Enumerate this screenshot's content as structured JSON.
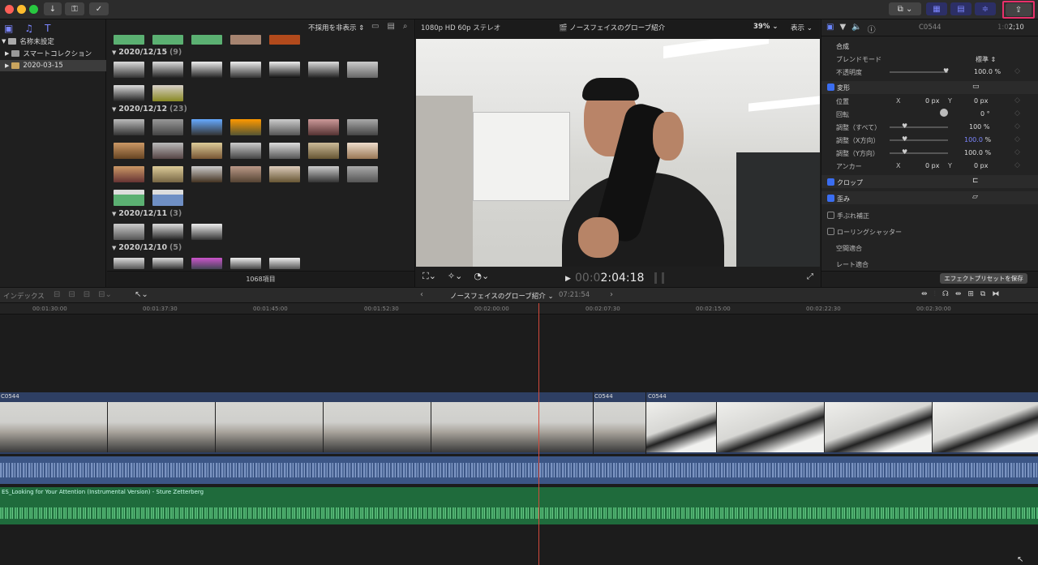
{
  "toolbar": {
    "export_icon": "share-export-icon",
    "import_icon": "download-arrow-icon",
    "key_icon": "keywords-icon",
    "check_icon": "background-tasks-icon"
  },
  "library": {
    "items": [
      {
        "label": "名称未設定"
      },
      {
        "label": "スマートコレクション"
      },
      {
        "label": "2020-03-15"
      }
    ]
  },
  "browser": {
    "filter_label": "不採用を非表示 ⇕",
    "groups": [
      {
        "date": "2020/12/15",
        "count": "(9)"
      },
      {
        "date": "2020/12/12",
        "count": "(23)"
      },
      {
        "date": "2020/12/11",
        "count": "(3)"
      },
      {
        "date": "2020/12/10",
        "count": "(5)"
      }
    ],
    "item_count": "1068項目"
  },
  "viewer": {
    "format": "1080p HD 60p ステレオ",
    "title": "ノースフェイスのグローブ紹介",
    "zoom": "39%",
    "view_menu": "表示",
    "timecode_dim": "00:0",
    "timecode": "2:04:18"
  },
  "inspector": {
    "clip_name": "C0544",
    "duration_dim": "1:0",
    "duration": "2;10",
    "compositing": "合成",
    "blend_mode_label": "ブレンドモード",
    "blend_mode_value": "標準 ⇕",
    "opacity_label": "不透明度",
    "opacity_value": "100.0",
    "transform": "変形",
    "position_label": "位置",
    "x": "X",
    "y": "Y",
    "pos_x": "0",
    "pos_y": "0",
    "px": "px",
    "rotation_label": "回転",
    "rotation_value": "0",
    "degree": "°",
    "scale_all_label": "調整（すべて）",
    "scale_all_value": "100",
    "scale_x_label": "調整（X方向）",
    "scale_x_value": "100.0",
    "scale_y_label": "調整（Y方向）",
    "scale_y_value": "100.0",
    "percent": "%",
    "anchor_label": "アンカー",
    "anchor_x": "0",
    "anchor_y": "0",
    "crop": "クロップ",
    "distort": "歪み",
    "stabilization": "手ぶれ補正",
    "rolling_shutter": "ローリングシャッター",
    "spatial_conform": "空間適合",
    "rate_conform": "レート適合",
    "save_preset": "エフェクトプリセットを保存"
  },
  "timeline": {
    "index": "インデックス",
    "project": "ノースフェイスのグローブ紹介",
    "project_duration": "07:21:54",
    "ruler": [
      "00:01:30:00",
      "00:01:37:30",
      "00:01:45:00",
      "00:01:52:30",
      "00:02:00:00",
      "00:02:07:30",
      "00:02:15:00",
      "00:02:22:30",
      "00:02:30:00"
    ],
    "clip_label": "C0544",
    "music_label": "ES_Looking for Your Attention (Instrumental Version) - Sture Zetterberg"
  },
  "colors": {
    "accent": "#3a6df0",
    "export_highlight": "#e8306a",
    "clip_blue": "#2e3f63",
    "music_green": "#1f6b3c"
  }
}
